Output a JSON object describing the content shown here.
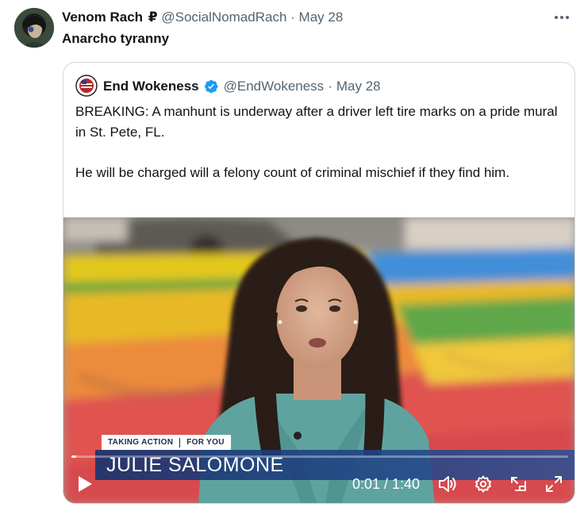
{
  "tweet": {
    "author_name": "Venom Rach",
    "author_badge": "₽",
    "author_handle": "@SocialNomadRach",
    "separator": "·",
    "date": "May 28",
    "text": "Anarcho tyranny",
    "more_icon": "more-horizontal-icon"
  },
  "quoted_tweet": {
    "author_name": "End Wokeness",
    "verified_icon": "verified-badge-icon",
    "verified_color": "#1d9bf0",
    "author_handle": "@EndWokeness",
    "separator": "·",
    "date": "May 28",
    "paragraph_1": "BREAKING: A manhunt is underway after a driver left tire marks on a pride mural in St. Pete, FL.",
    "paragraph_2": "He will be charged will a felony count of criminal mischief if they find him."
  },
  "video": {
    "chyron_tag_1": "TAKING ACTION",
    "chyron_tag_2": "FOR YOU",
    "chyron_name": "JULIE SALOMONE",
    "time_display": "0:01 / 1:40",
    "progress": 0.0,
    "icons": {
      "play": "play-icon",
      "volume": "volume-icon",
      "settings": "gear-icon",
      "pip": "picture-in-picture-icon",
      "fullscreen": "fullscreen-icon"
    }
  },
  "colors": {
    "text_primary": "#0f1419",
    "text_secondary": "#536471",
    "border": "#cfd9de",
    "chyron_blue": "#18346e"
  }
}
